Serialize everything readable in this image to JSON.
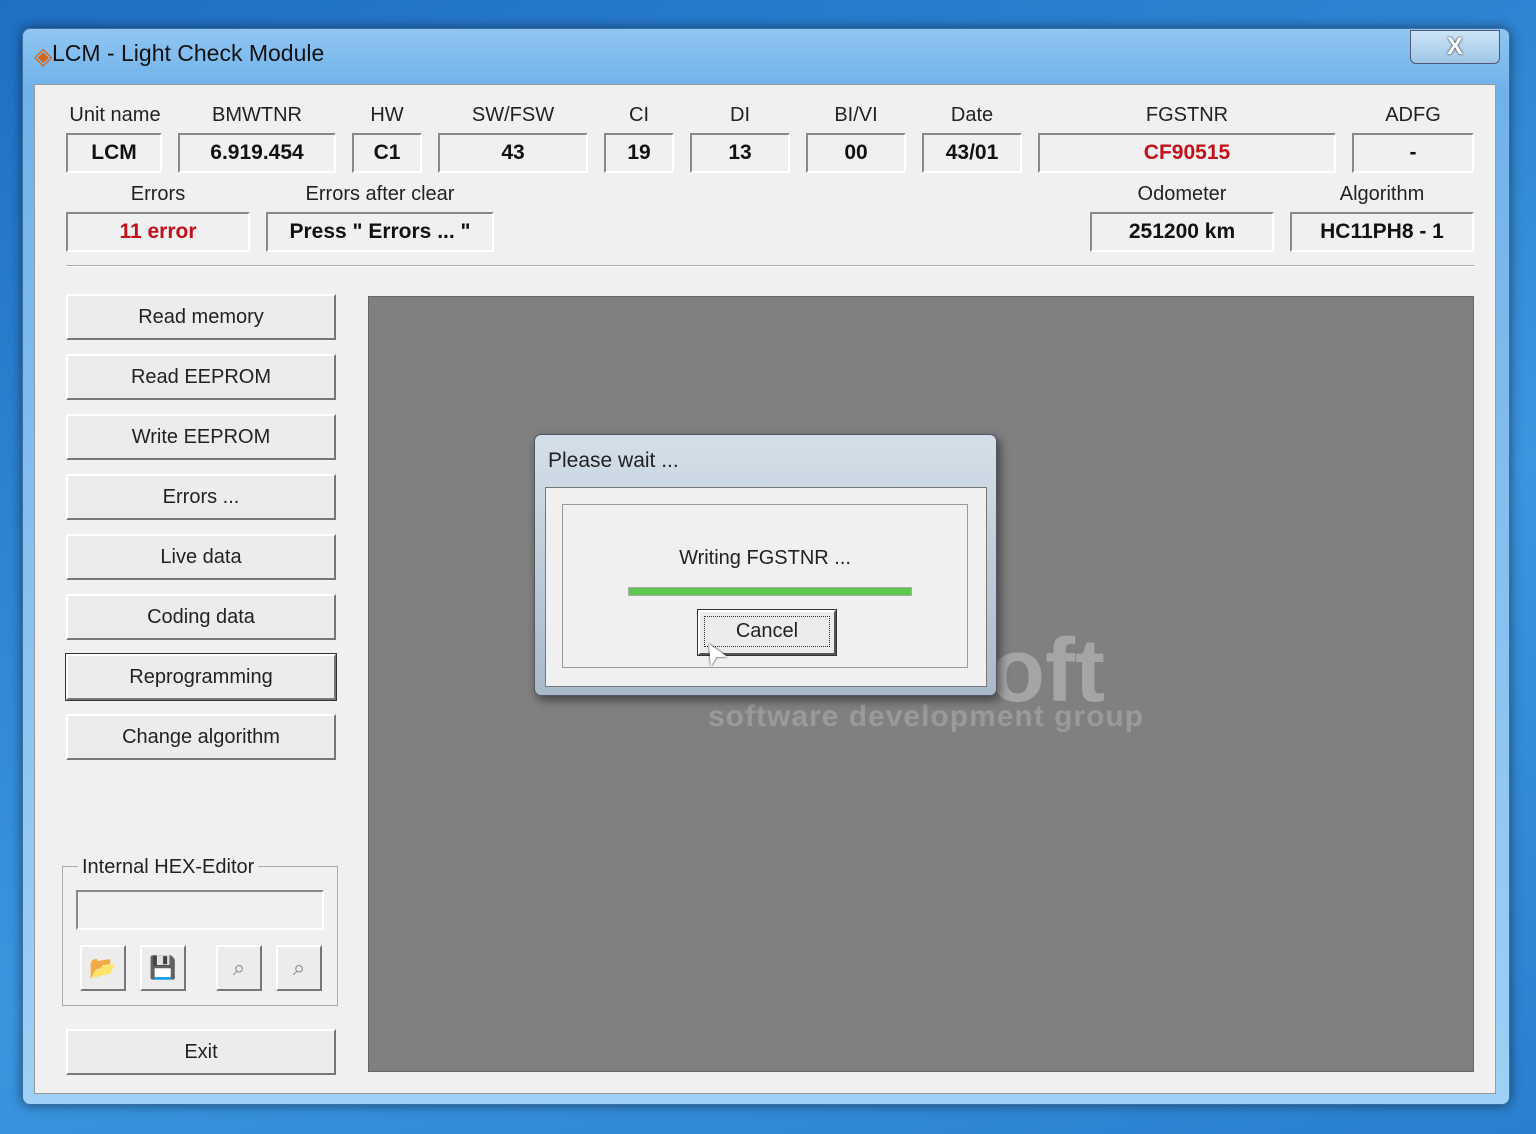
{
  "window": {
    "title": "LCM - Light Check Module",
    "close": "X"
  },
  "fields": {
    "unit_name": {
      "label": "Unit name",
      "value": "LCM"
    },
    "bmwtnr": {
      "label": "BMWTNR",
      "value": "6.919.454"
    },
    "hw": {
      "label": "HW",
      "value": "C1"
    },
    "swfsw": {
      "label": "SW/FSW",
      "value": "43"
    },
    "ci": {
      "label": "CI",
      "value": "19"
    },
    "di": {
      "label": "DI",
      "value": "13"
    },
    "bivi": {
      "label": "BI/VI",
      "value": "00"
    },
    "date": {
      "label": "Date",
      "value": "43/01"
    },
    "fgstnr": {
      "label": "FGSTNR",
      "value": "CF90515"
    },
    "adfg": {
      "label": "ADFG",
      "value": "-"
    },
    "errors": {
      "label": "Errors",
      "value": "11 error"
    },
    "errors_after_clear": {
      "label": "Errors after clear",
      "value": "Press \" Errors ... \""
    },
    "odometer": {
      "label": "Odometer",
      "value": "251200 km"
    },
    "algorithm": {
      "label": "Algorithm",
      "value": "HC11PH8 - 1"
    }
  },
  "buttons": [
    "Read memory",
    "Read EEPROM",
    "Write EEPROM",
    "Errors ...",
    "Live data",
    "Coding data",
    "Reprogramming",
    "Change algorithm"
  ],
  "hex_editor": {
    "label": "Internal HEX-Editor",
    "value": ""
  },
  "exit": "Exit",
  "watermark": {
    "big": "oft",
    "small": "software development group"
  },
  "dialog": {
    "title": "Please wait ...",
    "message": "Writing FGSTNR ...",
    "progress": 100,
    "cancel": "Cancel",
    "progress_color": "#5cc84e"
  }
}
